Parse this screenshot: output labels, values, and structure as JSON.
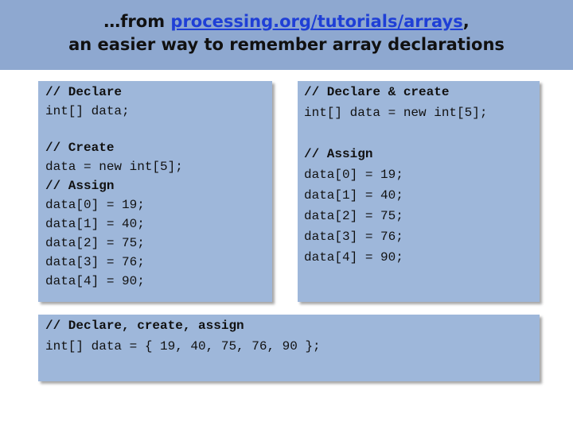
{
  "title": {
    "prefix": "…from ",
    "link_text": " processing.org/tutorials/arrays",
    "suffix": ",",
    "line2": "an easier way to remember array declarations"
  },
  "box_left": {
    "lines": [
      "// Declare",
      "int[] data;",
      "// Create",
      "data = new int[5];",
      "// Assign",
      "data[0] = 19;",
      "data[1] = 40;",
      "data[2] = 75;",
      "data[3] = 76;",
      "data[4] = 90;"
    ]
  },
  "box_right": {
    "lines": [
      "// Declare & create",
      "int[] data = new int[5];",
      "// Assign",
      "data[0] = 19;",
      "data[1] = 40;",
      "data[2] = 75;",
      "data[3] = 76;",
      "data[4] = 90;"
    ]
  },
  "box_bottom": {
    "lines": [
      "// Declare, create, assign",
      "int[] data = { 19, 40, 75, 76, 90 };"
    ]
  },
  "colors": {
    "title_bar": "#8ea8d0",
    "code_box": "#9eb7da",
    "link": "#1f3fd6"
  }
}
